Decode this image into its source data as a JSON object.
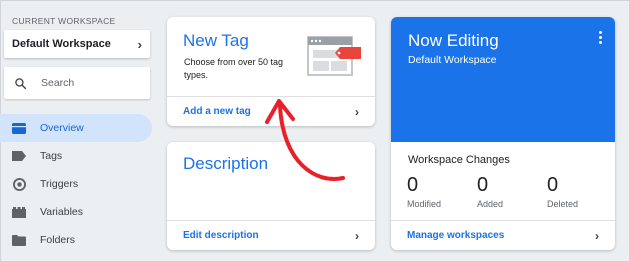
{
  "sidebar": {
    "workspace_caption": "CURRENT WORKSPACE",
    "workspace_name": "Default Workspace",
    "search_placeholder": "Search",
    "items": [
      {
        "label": "Overview",
        "icon": "overview-icon"
      },
      {
        "label": "Tags",
        "icon": "tag-icon"
      },
      {
        "label": "Triggers",
        "icon": "trigger-icon"
      },
      {
        "label": "Variables",
        "icon": "variables-icon"
      },
      {
        "label": "Folders",
        "icon": "folder-icon"
      }
    ]
  },
  "new_tag_card": {
    "title": "New Tag",
    "description": "Choose from over 50 tag types.",
    "link": "Add a new tag"
  },
  "description_card": {
    "title": "Description",
    "link": "Edit description"
  },
  "editing_card": {
    "title": "Now Editing",
    "workspace": "Default Workspace",
    "changes_title": "Workspace Changes",
    "stats": [
      {
        "value": "0",
        "label": "Modified"
      },
      {
        "value": "0",
        "label": "Added"
      },
      {
        "value": "0",
        "label": "Deleted"
      }
    ],
    "link": "Manage workspaces"
  },
  "colors": {
    "accent": "#1a73e8",
    "annotation_arrow": "#e8202a",
    "nav_active_bg": "#d2e3fc"
  }
}
